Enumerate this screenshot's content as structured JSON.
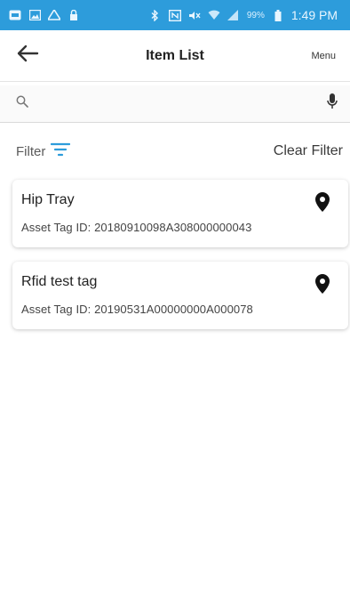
{
  "status_bar": {
    "time": "1:49 PM",
    "battery": "99%",
    "icons_left": [
      "notification-icon",
      "gallery-icon",
      "drive-icon",
      "lock-icon"
    ],
    "icons_right": [
      "bluetooth-icon",
      "nfc-icon",
      "mute-icon",
      "wifi-icon",
      "signal-icon",
      "battery-icon"
    ],
    "color": "#2d9cdb"
  },
  "app_bar": {
    "title": "Item List",
    "menu_label": "Menu"
  },
  "search": {
    "placeholder": "",
    "value": ""
  },
  "filter": {
    "label": "Filter",
    "clear_label": "Clear Filter",
    "accent": "#2d9cdb"
  },
  "items": [
    {
      "name": "Hip Tray",
      "tag_line": "Asset Tag ID: 20180910098A308000000043"
    },
    {
      "name": "Rfid test tag",
      "tag_line": "Asset Tag ID: 20190531A00000000A000078"
    }
  ]
}
